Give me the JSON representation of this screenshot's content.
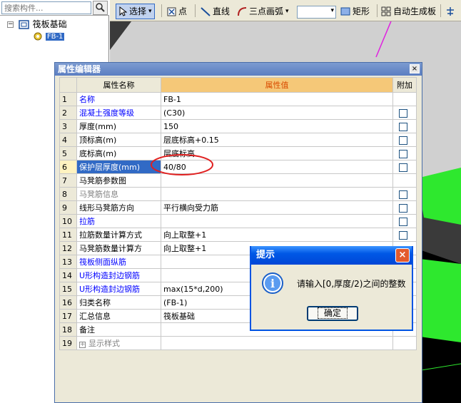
{
  "search": {
    "placeholder": "搜索构件..."
  },
  "tree": {
    "root_label": "筏板基础",
    "child_label": "FB-1",
    "toggle": "⊟"
  },
  "toolbar": {
    "select_label": "选择",
    "point_label": "点",
    "line_label": "直线",
    "arc_label": "三点画弧",
    "rect_label": "矩形",
    "auto_label": "自动生成板",
    "icons": [
      "cursor-icon",
      "point-icon",
      "line-icon",
      "arc-icon",
      "rect-icon",
      "auto-generate-icon",
      "more-icon"
    ]
  },
  "dialog": {
    "title": "属性编辑器",
    "close_glyph": "×",
    "headers": {
      "name": "属性名称",
      "value": "属性值",
      "extra": "附加"
    },
    "rows": [
      {
        "num": "1",
        "name": "名称",
        "value": "FB-1",
        "style": "blue",
        "checkbox": false
      },
      {
        "num": "2",
        "name": "混凝土强度等级",
        "value": "(C30)",
        "style": "blue",
        "checkbox": true
      },
      {
        "num": "3",
        "name": "厚度(mm)",
        "value": "150",
        "style": "normal",
        "checkbox": true
      },
      {
        "num": "4",
        "name": "顶标高(m)",
        "value": "层底标高+0.15",
        "style": "normal",
        "checkbox": true
      },
      {
        "num": "5",
        "name": "底标高(m)",
        "value": "层底标高",
        "style": "normal",
        "checkbox": true
      },
      {
        "num": "6",
        "name": "保护层厚度(mm)",
        "value": "40/80",
        "style": "active",
        "checkbox": true
      },
      {
        "num": "7",
        "name": "马凳筋参数图",
        "value": "",
        "style": "normal",
        "checkbox": false
      },
      {
        "num": "8",
        "name": "马凳筋信息",
        "value": "",
        "style": "gray",
        "checkbox": true
      },
      {
        "num": "9",
        "name": "线形马凳筋方向",
        "value": "平行横向受力筋",
        "style": "normal",
        "checkbox": true
      },
      {
        "num": "10",
        "name": "拉筋",
        "value": "",
        "style": "blue",
        "checkbox": true
      },
      {
        "num": "11",
        "name": "拉筋数量计算方式",
        "value": "向上取整+1",
        "style": "normal",
        "checkbox": true
      },
      {
        "num": "12",
        "name": "马凳筋数量计算方",
        "value": "向上取整+1",
        "style": "normal",
        "checkbox": false
      },
      {
        "num": "13",
        "name": "筏板侧面纵筋",
        "value": "",
        "style": "blue",
        "checkbox": false
      },
      {
        "num": "14",
        "name": "U形构造封边钢筋",
        "value": "",
        "style": "blue",
        "checkbox": false
      },
      {
        "num": "15",
        "name": "U形构造封边钢筋",
        "value": "max(15*d,200)",
        "style": "blue",
        "checkbox": false
      },
      {
        "num": "16",
        "name": "归类名称",
        "value": "(FB-1)",
        "style": "normal",
        "checkbox": false
      },
      {
        "num": "17",
        "name": "汇总信息",
        "value": "筏板基础",
        "style": "normal",
        "checkbox": false
      },
      {
        "num": "18",
        "name": "备注",
        "value": "",
        "style": "normal",
        "checkbox": false
      },
      {
        "num": "19",
        "name": "显示样式",
        "value": "",
        "style": "gray-plus",
        "checkbox": false
      }
    ]
  },
  "alert": {
    "title": "提示",
    "message": "请输入[0,厚度/2)之间的整数",
    "ok_label": "确定",
    "close_glyph": "×",
    "icon_glyph": "i"
  },
  "colors": {
    "highlight_circle": "#e02020",
    "green_object": "#2ee82e",
    "magenta_line": "#e020e0"
  }
}
